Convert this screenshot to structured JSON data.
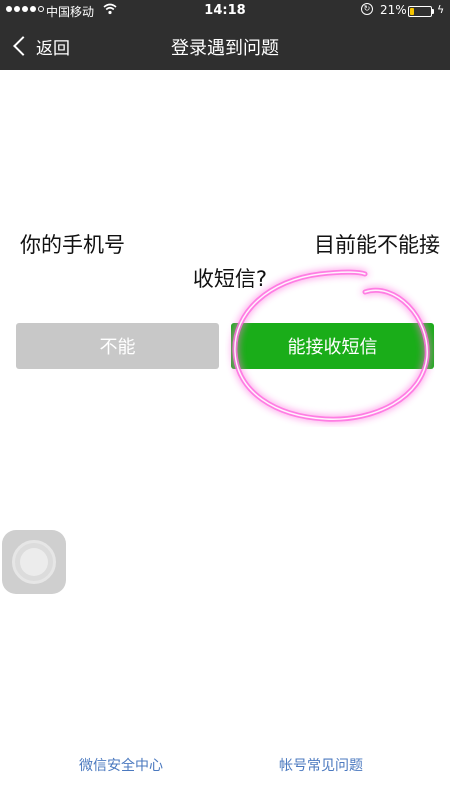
{
  "status_bar": {
    "carrier": "中国移动",
    "time": "14:18",
    "battery_percent": "21%",
    "battery_level": 0.21,
    "signal_bars": 4
  },
  "header": {
    "back_label": "返回",
    "title": "登录遇到问题"
  },
  "question": {
    "line1_left": "你的手机号",
    "line1_right": "目前能不能接",
    "line2": "收短信?"
  },
  "buttons": {
    "no_label": "不能",
    "yes_label": "能接收短信"
  },
  "footer": {
    "security_center": "微信安全中心",
    "account_faq": "帐号常见问题"
  },
  "colors": {
    "header_bg": "#2f2f2f",
    "accent_green": "#1aad19",
    "disabled_gray": "#c8c8c8",
    "link_blue": "#4b79bf",
    "annotation_pink": "#ff4fd0"
  }
}
